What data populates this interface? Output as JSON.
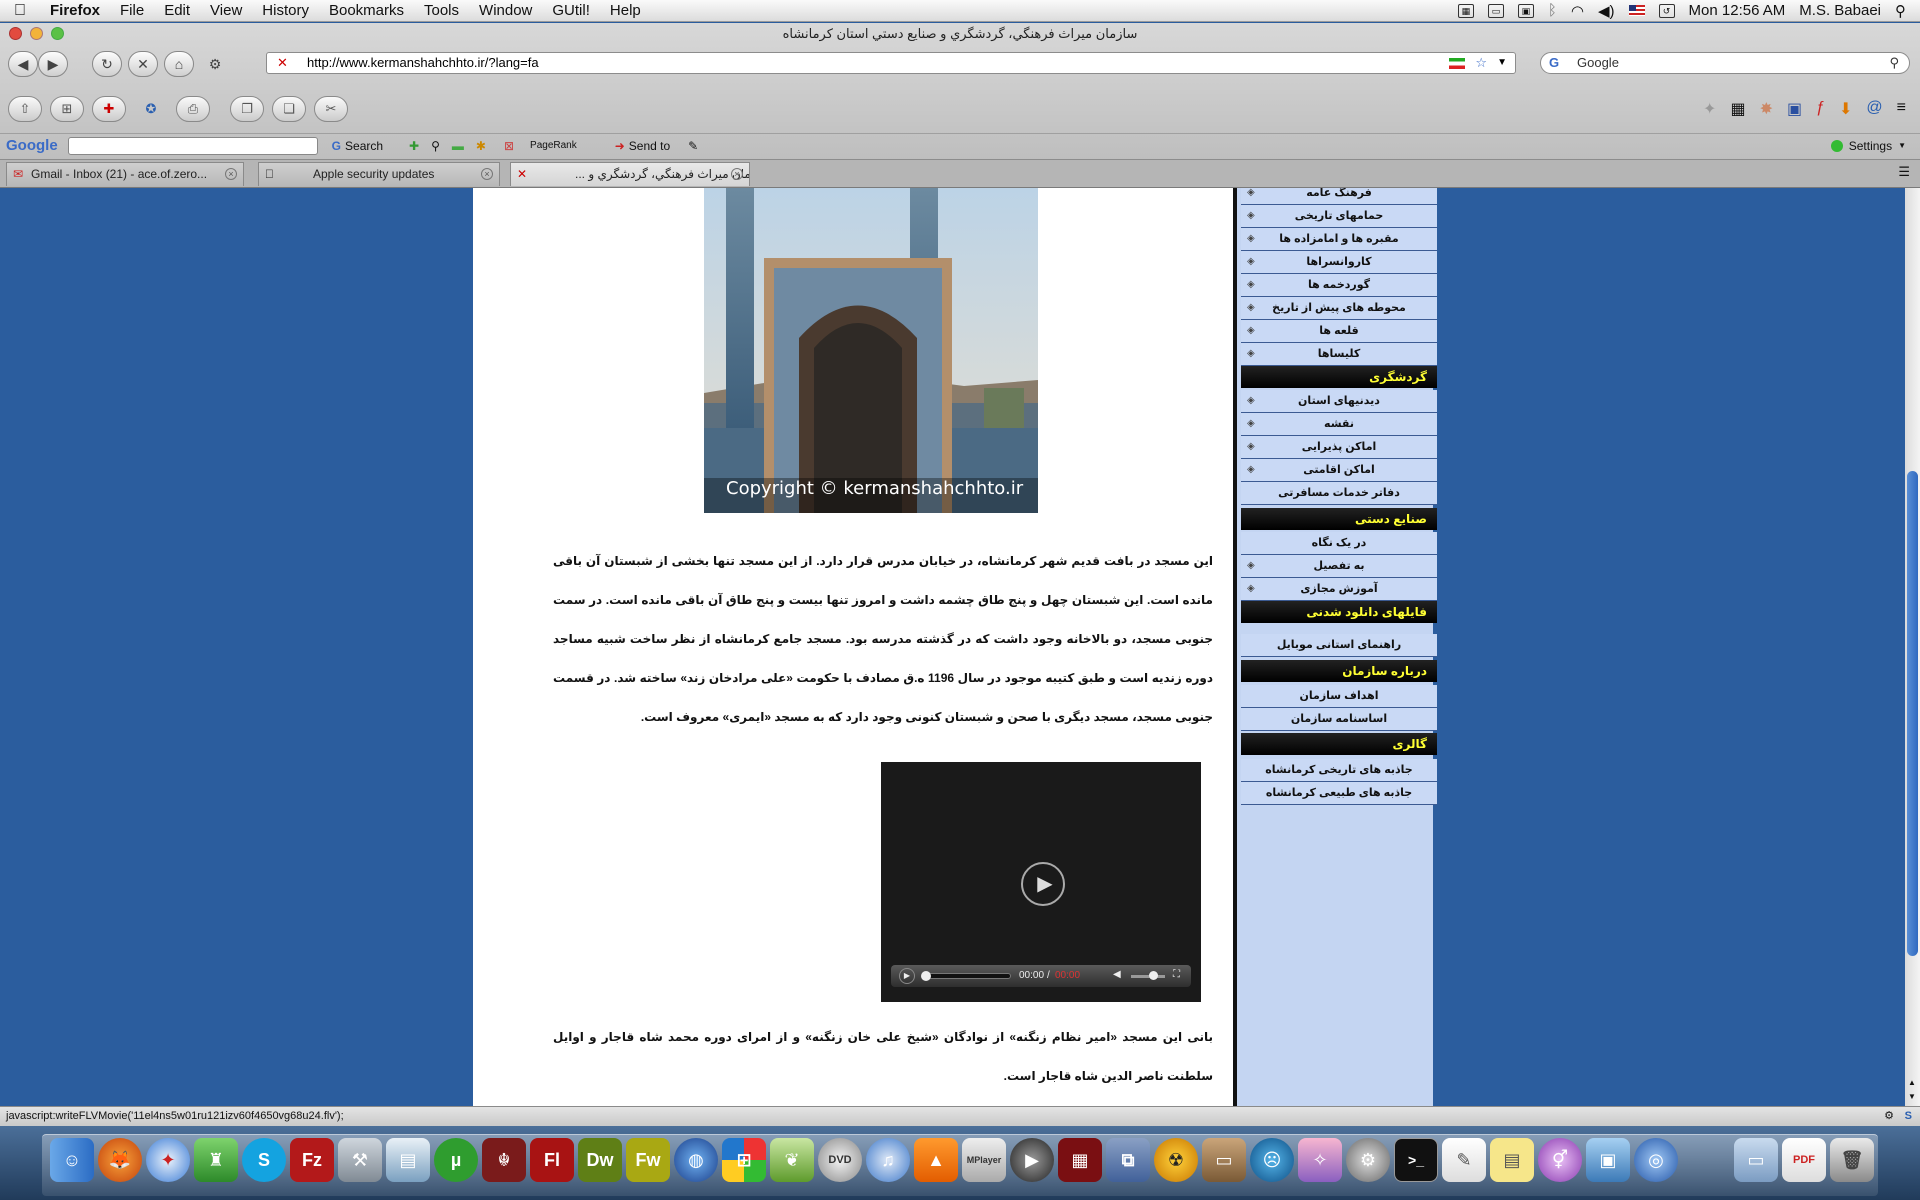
{
  "menubar": {
    "app": "Firefox",
    "items": [
      "File",
      "Edit",
      "View",
      "History",
      "Bookmarks",
      "Tools",
      "Window",
      "GUtil!",
      "Help"
    ],
    "clock": "Mon 12:56 AM",
    "user": "M.S. Babaei"
  },
  "window": {
    "title": "سازمان میراث فرهنگي، گردشگري و صنايع دستي استان کرمانشاه"
  },
  "nav": {
    "url": "http://www.kermanshahchhto.ir/?lang=fa",
    "search_placeholder": "Google"
  },
  "googlebar": {
    "logo": "Google",
    "search_label": "Search",
    "pagerank_label": "PageRank",
    "sendto_label": "Send to",
    "settings_label": "Settings"
  },
  "tabs": [
    {
      "label": "Gmail - Inbox (21) - ace.of.zero..."
    },
    {
      "label": "Apple security updates"
    },
    {
      "label": "سازمان میراث فرهنگي، گردشگري و ..."
    }
  ],
  "page": {
    "photo_caption": "Copyright © kermanshahchhto.ir",
    "paragraph1": "این مسجد در بافت قدیم شهر کرمانشاه، در خیابان مدرس قرار دارد. از این مسجد تنها بخشی از شبستان آن باقی مانده است. این شبستان چهل و پنج طاق چشمه داشت و امروز تنها بیست و پنج طاق آن باقی مانده است. در سمت جنوبی مسجد، دو بالاخانه وجود داشت که در گذشته مدرسه بود. مسجد جامع کرمانشاه از نظر ساخت شبیه مساجد دوره زندیه است و طبق کتیبه موجود در سال 1196 ه.ق مصادف با حکومت «علی مرادخان زند» ساخته شد. در قسمت جنوبی مسجد، مسجد دیگری با صحن و شبستان کنونی وجود دارد که به مسجد «ایمری» معروف است.",
    "video_time": "00:00",
    "video_total": "00:00",
    "paragraph2": "بانی این مسجد «امیر نظام زنگنه» از نوادگان «شیخ علی خان زنگنه» و از امرای دوره محمد شاه قاجار و اوایل سلطنت ناصر الدین شاه قاجار است."
  },
  "sidebar": {
    "group1_items": [
      "فرهنگ عامه",
      "حمامهای تاریخی",
      "مقبره ها و امامزاده ها",
      "کاروانسراها",
      "گوردخمه ها",
      "محوطه های پیش از تاریخ",
      "قلعه ها",
      "کلیساها"
    ],
    "heading_tourism": "گردشگری",
    "tourism_items": [
      "دیدنیهای استان",
      "نقشه",
      "اماکن پذیرایی",
      "اماکن اقامتی",
      "دفاتر خدمات مسافرتی"
    ],
    "heading_handicrafts": "صنایع دستی",
    "handicraft_items": [
      "در یک نگاه",
      "به تفصیل",
      "آموزش مجازی"
    ],
    "heading_downloads": "فایلهای دانلود شدنی",
    "download_items": [
      "راهنمای استانی موبایل"
    ],
    "heading_about": "درباره سازمان",
    "about_items": [
      "اهداف سازمان",
      "اساسنامه سازمان"
    ],
    "heading_gallery": "گالری",
    "gallery_items": [
      "جاذبه های تاریخی کرمانشاه",
      "جاذبه های طبیعی کرمانشاه"
    ]
  },
  "status": {
    "text": "javascript:writeFLVMovie('11el4ns5w01ru121izv60f4650vg68u24.flv');"
  },
  "dock": {
    "labels": [
      "Fl",
      "Dw",
      "Fw"
    ]
  }
}
